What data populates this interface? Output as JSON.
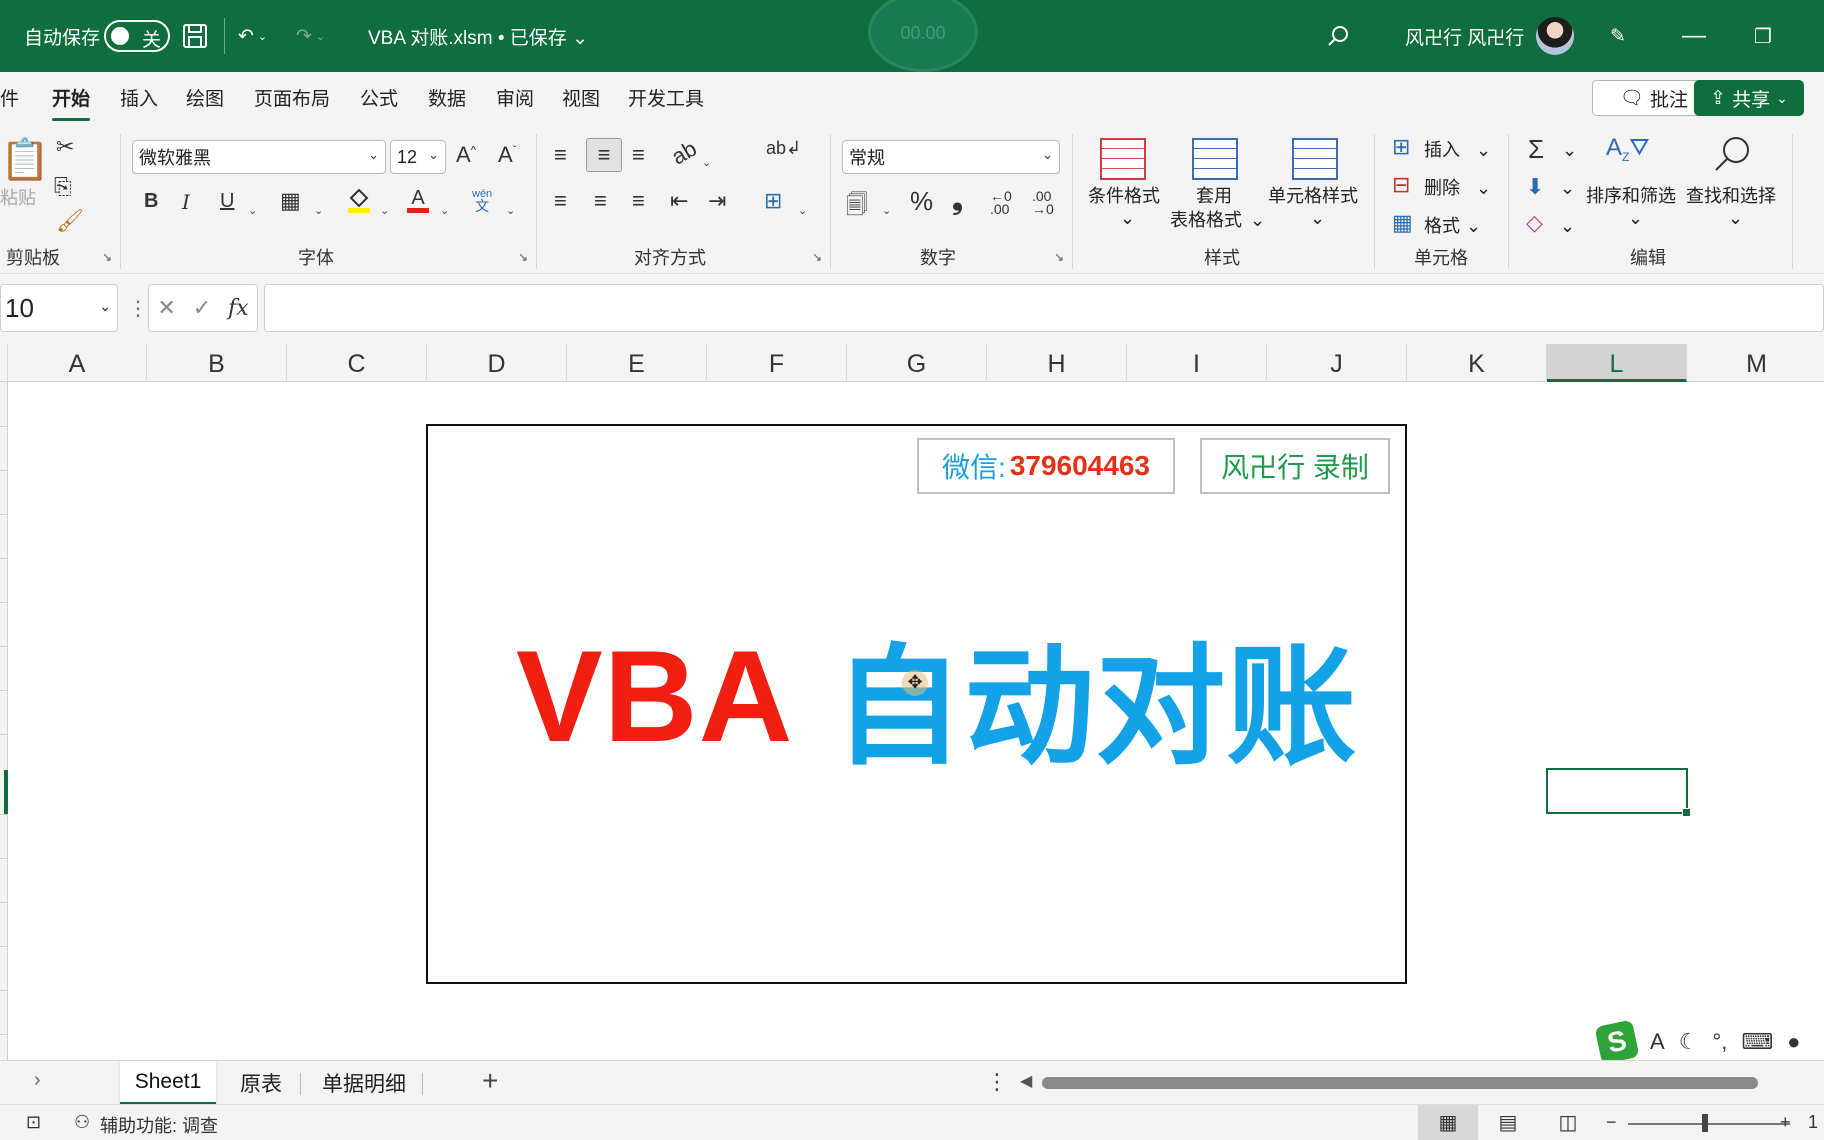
{
  "titlebar": {
    "autosave_label": "自动保存",
    "autosave_state": "关",
    "filename": "VBA 对账.xlsm • 已保存 ⌄",
    "recorder_time": "00.00",
    "user": "风卍行 风卍行"
  },
  "menu": {
    "tabs": [
      "件",
      "开始",
      "插入",
      "绘图",
      "页面布局",
      "公式",
      "数据",
      "审阅",
      "视图",
      "开发工具"
    ],
    "comment_label": "批注",
    "share_label": "共享"
  },
  "ribbon": {
    "clipboard": {
      "paste_label": "粘贴",
      "group_label": "剪贴板"
    },
    "font": {
      "name": "微软雅黑",
      "size": "12",
      "group_label": "字体",
      "bold": "B",
      "italic": "I",
      "underline": "U",
      "font_color_letter": "A",
      "phonetic_top": "wén",
      "phonetic_bottom": "文"
    },
    "alignment": {
      "group_label": "对齐方式"
    },
    "number": {
      "format": "常规",
      "group_label": "数字"
    },
    "styles": {
      "conditional_label": "条件格式",
      "table_label_1": "套用",
      "table_label_2": "表格格式",
      "cell_styles_label": "单元格样式",
      "group_label": "样式"
    },
    "cells": {
      "insert_label": "插入",
      "delete_label": "删除",
      "format_label": "格式",
      "group_label": "单元格"
    },
    "editing": {
      "sort_label": "排序和筛选",
      "find_label": "查找和选择",
      "group_label": "编辑"
    }
  },
  "formula_bar": {
    "name_box": "10",
    "fx": "fx",
    "value": ""
  },
  "columns": [
    "A",
    "B",
    "C",
    "D",
    "E",
    "F",
    "G",
    "H",
    "I",
    "J",
    "K",
    "L",
    "M"
  ],
  "selected_column": "L",
  "banner": {
    "wechat_label": "微信:",
    "wechat_number": "379604463",
    "recorded_by": "风卍行 录制",
    "title_latin": "VBA",
    "title_cn": "自动对账"
  },
  "sheets": {
    "tabs": [
      "Sheet1",
      "原表",
      "单据明细"
    ],
    "active": "Sheet1"
  },
  "status": {
    "accessibility": "辅助功能: 调查",
    "zoom_tail": "1"
  },
  "colors": {
    "excel_green": "#0e6e3d",
    "accent_red": "#f01f0f",
    "accent_blue": "#13a1e8",
    "recorded_green": "#1f9a4a"
  }
}
